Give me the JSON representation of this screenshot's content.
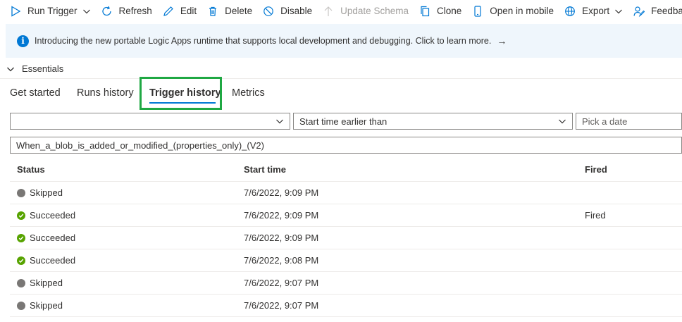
{
  "toolbar": {
    "run_trigger": "Run Trigger",
    "refresh": "Refresh",
    "edit": "Edit",
    "delete": "Delete",
    "disable": "Disable",
    "update_schema": "Update Schema",
    "clone": "Clone",
    "open_in_mobile": "Open in mobile",
    "export": "Export",
    "feedback": "Feedback"
  },
  "banner": {
    "text": "Introducing the new portable Logic Apps runtime that supports local development and debugging. Click to learn more.",
    "arrow": "→"
  },
  "essentials": {
    "label": "Essentials"
  },
  "tabs": [
    {
      "label": "Get started"
    },
    {
      "label": "Runs history"
    },
    {
      "label": "Trigger history"
    },
    {
      "label": "Metrics"
    }
  ],
  "active_tab": "Trigger history",
  "filters": {
    "status_value": "",
    "time_filter": "Start time earlier than",
    "date_placeholder": "Pick a date",
    "trigger_name": "When_a_blob_is_added_or_modified_(properties_only)_(V2)"
  },
  "table": {
    "headers": {
      "status": "Status",
      "start_time": "Start time",
      "fired": "Fired"
    },
    "rows": [
      {
        "status": "Skipped",
        "start_time": "7/6/2022, 9:09 PM",
        "fired": ""
      },
      {
        "status": "Succeeded",
        "start_time": "7/6/2022, 9:09 PM",
        "fired": "Fired"
      },
      {
        "status": "Succeeded",
        "start_time": "7/6/2022, 9:09 PM",
        "fired": ""
      },
      {
        "status": "Succeeded",
        "start_time": "7/6/2022, 9:08 PM",
        "fired": ""
      },
      {
        "status": "Skipped",
        "start_time": "7/6/2022, 9:07 PM",
        "fired": ""
      },
      {
        "status": "Skipped",
        "start_time": "7/6/2022, 9:07 PM",
        "fired": ""
      }
    ]
  },
  "colors": {
    "accent": "#0078d4",
    "success": "#57a300",
    "skipped": "#797775",
    "highlight": "#1fa843",
    "banner_bg": "#eff6fc"
  }
}
